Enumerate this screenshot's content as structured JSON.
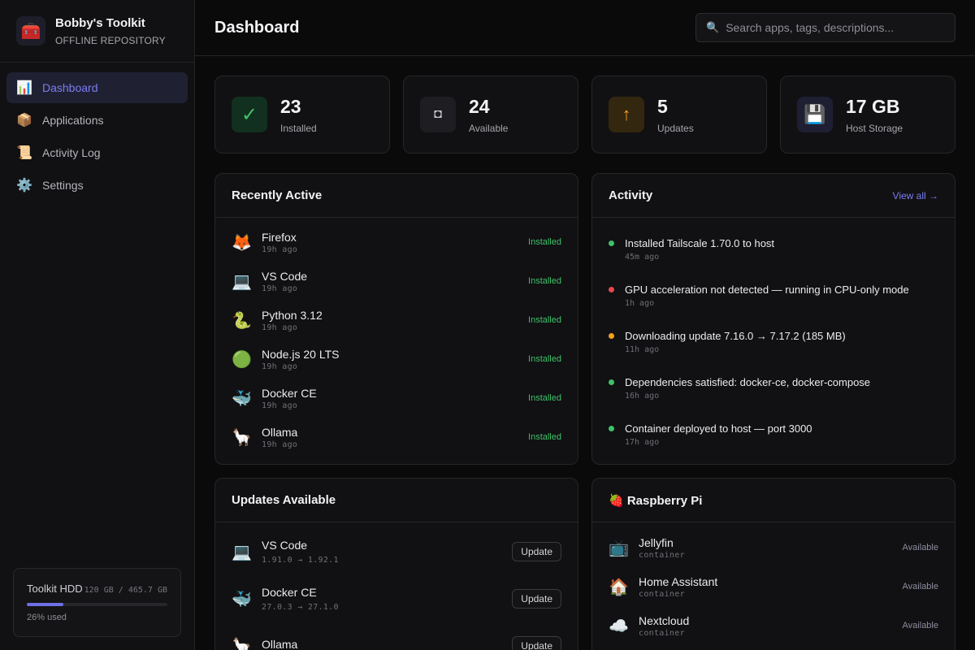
{
  "brand": {
    "icon": "toolbox-icon",
    "title": "Bobby's Toolkit",
    "subtitle": "OFFLINE REPOSITORY"
  },
  "nav": [
    {
      "label": "Dashboard",
      "icon": "chart-icon",
      "active": true
    },
    {
      "label": "Applications",
      "icon": "package-icon",
      "active": false
    },
    {
      "label": "Activity Log",
      "icon": "scroll-icon",
      "active": false
    },
    {
      "label": "Settings",
      "icon": "gear-icon",
      "active": false
    }
  ],
  "storage": {
    "title": "Toolkit HDD",
    "amount": "120 GB / 465.7 GB",
    "used_label": "26% used",
    "used_fraction": 0.26
  },
  "header": {
    "title": "Dashboard",
    "search_placeholder": "Search apps, tags, descriptions..."
  },
  "stats": [
    {
      "value": "23",
      "label": "Installed",
      "icon": "check-icon",
      "glyph": "✓",
      "bg": "#12301f",
      "color": "#3fc16a"
    },
    {
      "value": "24",
      "label": "Available",
      "icon": "square-icon",
      "glyph": "◘",
      "bg": "#1e1e22",
      "color": "#c8c8cf"
    },
    {
      "value": "5",
      "label": "Updates",
      "icon": "arrow-up-icon",
      "glyph": "↑",
      "bg": "#33270f",
      "color": "#f0a020"
    },
    {
      "value": "17 GB",
      "label": "Host Storage",
      "icon": "floppy-icon",
      "glyph": "💾",
      "bg": "#1e1f33",
      "color": "#9a9af0"
    }
  ],
  "recent": {
    "title": "Recently Active",
    "items": [
      {
        "icon": "🦊",
        "icon_name": "firefox-icon",
        "name": "Firefox",
        "time": "19h ago",
        "status": "Installed"
      },
      {
        "icon": "💻",
        "icon_name": "laptop-icon",
        "name": "VS Code",
        "time": "19h ago",
        "status": "Installed"
      },
      {
        "icon": "🐍",
        "icon_name": "snake-icon",
        "name": "Python 3.12",
        "time": "19h ago",
        "status": "Installed"
      },
      {
        "icon": "🟢",
        "icon_name": "green-circle-icon",
        "name": "Node.js 20 LTS",
        "time": "19h ago",
        "status": "Installed"
      },
      {
        "icon": "🐳",
        "icon_name": "whale-icon",
        "name": "Docker CE",
        "time": "19h ago",
        "status": "Installed"
      },
      {
        "icon": "🦙",
        "icon_name": "llama-icon",
        "name": "Ollama",
        "time": "19h ago",
        "status": "Installed"
      }
    ]
  },
  "activity": {
    "title": "Activity",
    "view_all": "View all →",
    "items": [
      {
        "text": "Installed Tailscale 1.70.0 to host",
        "time": "45m ago",
        "color": "#3fc16a"
      },
      {
        "text": "GPU acceleration not detected — running in CPU-only mode",
        "time": "1h ago",
        "color": "#e5484d"
      },
      {
        "text": "Downloading update 7.16.0 → 7.17.2 (185 MB)",
        "time": "11h ago",
        "color": "#f0a020"
      },
      {
        "text": "Dependencies satisfied: docker-ce, docker-compose",
        "time": "16h ago",
        "color": "#3fc16a"
      },
      {
        "text": "Container deployed to host — port 3000",
        "time": "17h ago",
        "color": "#3fc16a"
      }
    ]
  },
  "updates": {
    "title": "Updates Available",
    "button_label": "Update",
    "items": [
      {
        "icon": "💻",
        "icon_name": "laptop-icon",
        "name": "VS Code",
        "version": "1.91.0 → 1.92.1"
      },
      {
        "icon": "🐳",
        "icon_name": "whale-icon",
        "name": "Docker CE",
        "version": "27.0.3 → 27.1.0"
      },
      {
        "icon": "🦙",
        "icon_name": "llama-icon",
        "name": "Ollama",
        "version": ""
      }
    ]
  },
  "raspberry": {
    "title": "🍓 Raspberry Pi",
    "items": [
      {
        "icon": "📺",
        "icon_name": "tv-icon",
        "name": "Jellyfin",
        "type": "container",
        "status": "Available"
      },
      {
        "icon": "🏠",
        "icon_name": "house-icon",
        "name": "Home Assistant",
        "type": "container",
        "status": "Available"
      },
      {
        "icon": "☁️",
        "icon_name": "cloud-icon",
        "name": "Nextcloud",
        "type": "container",
        "status": "Available"
      }
    ]
  }
}
